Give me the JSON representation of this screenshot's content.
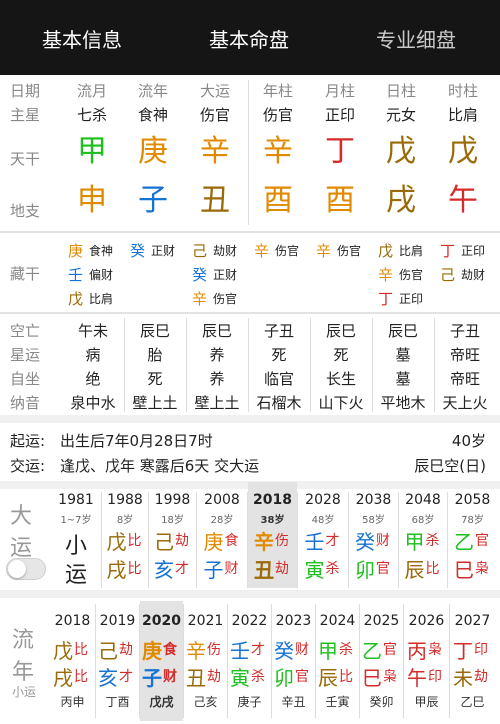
{
  "colors": {
    "wood": "#1fbf1f",
    "fire": "#d42b2b",
    "earth": "#9a6a06",
    "metal": "#e08a00",
    "water": "#1673d4",
    "gray": "#888888"
  },
  "tabs": [
    "基本信息",
    "基本命盘",
    "专业细盘"
  ],
  "grid": {
    "row_labels": [
      "日期",
      "主星",
      "天干",
      "地支"
    ],
    "dates": [
      "流月",
      "流年",
      "大运",
      "年柱",
      "月柱",
      "日柱",
      "时柱"
    ],
    "stars": [
      "七杀",
      "食神",
      "伤官",
      "伤官",
      "正印",
      "元女",
      "比肩"
    ],
    "stems": [
      {
        "t": "甲",
        "c": "wood"
      },
      {
        "t": "庚",
        "c": "metal"
      },
      {
        "t": "辛",
        "c": "metal"
      },
      {
        "t": "辛",
        "c": "metal"
      },
      {
        "t": "丁",
        "c": "fire"
      },
      {
        "t": "戊",
        "c": "earth"
      },
      {
        "t": "戊",
        "c": "earth"
      }
    ],
    "branches": [
      {
        "t": "申",
        "c": "metal"
      },
      {
        "t": "子",
        "c": "water"
      },
      {
        "t": "丑",
        "c": "earth"
      },
      {
        "t": "酉",
        "c": "metal"
      },
      {
        "t": "酉",
        "c": "metal"
      },
      {
        "t": "戌",
        "c": "earth"
      },
      {
        "t": "午",
        "c": "fire"
      }
    ]
  },
  "canggan": {
    "label": "藏干",
    "cols": [
      [
        {
          "s": "庚",
          "c": "metal",
          "n": "食神"
        },
        {
          "s": "壬",
          "c": "water",
          "n": "偏财"
        },
        {
          "s": "戊",
          "c": "earth",
          "n": "比肩"
        }
      ],
      [
        {
          "s": "癸",
          "c": "water",
          "n": "正财"
        }
      ],
      [
        {
          "s": "己",
          "c": "earth",
          "n": "劫财"
        },
        {
          "s": "癸",
          "c": "water",
          "n": "正财"
        },
        {
          "s": "辛",
          "c": "metal",
          "n": "伤官"
        }
      ],
      [
        {
          "s": "辛",
          "c": "metal",
          "n": "伤官"
        }
      ],
      [
        {
          "s": "辛",
          "c": "metal",
          "n": "伤官"
        }
      ],
      [
        {
          "s": "戊",
          "c": "earth",
          "n": "比肩"
        },
        {
          "s": "辛",
          "c": "metal",
          "n": "伤官"
        },
        {
          "s": "丁",
          "c": "fire",
          "n": "正印"
        }
      ],
      [
        {
          "s": "丁",
          "c": "fire",
          "n": "正印"
        },
        {
          "s": "己",
          "c": "earth",
          "n": "劫财"
        }
      ]
    ]
  },
  "extra": {
    "labels": [
      "空亡",
      "星运",
      "自坐",
      "纳音"
    ],
    "rows": [
      [
        "午未",
        "辰巳",
        "辰巳",
        "子丑",
        "辰巳",
        "辰巳",
        "子丑"
      ],
      [
        "病",
        "胎",
        "养",
        "死",
        "死",
        "墓",
        "帝旺"
      ],
      [
        "绝",
        "死",
        "养",
        "临官",
        "长生",
        "墓",
        "帝旺"
      ],
      [
        "泉中水",
        "壁上土",
        "壁上土",
        "石榴木",
        "山下火",
        "平地木",
        "天上火"
      ]
    ]
  },
  "qiyun": {
    "label1": "起运:",
    "text1": "出生后7年0月28日7时",
    "right1": "40岁",
    "label2": "交运:",
    "text2": "逢戊、戊年 寒露后6天 交大运",
    "right2": "辰巳空(日)"
  },
  "dayun": {
    "label": [
      "大",
      "运"
    ],
    "first": {
      "year": "1981",
      "age": "1~7岁",
      "t": [
        "小",
        "运"
      ]
    },
    "items": [
      {
        "year": "1988",
        "age": "8岁",
        "s": "戊",
        "sc": "earth",
        "sg": "比",
        "sgc": "fire",
        "b": "戌",
        "bc": "earth",
        "bg": "比",
        "bgc": "fire"
      },
      {
        "year": "1998",
        "age": "18岁",
        "s": "己",
        "sc": "earth",
        "sg": "劫",
        "sgc": "fire",
        "b": "亥",
        "bc": "water",
        "bg": "才",
        "bgc": "fire"
      },
      {
        "year": "2008",
        "age": "28岁",
        "s": "庚",
        "sc": "metal",
        "sg": "食",
        "sgc": "fire",
        "b": "子",
        "bc": "water",
        "bg": "财",
        "bgc": "fire"
      },
      {
        "year": "2018",
        "age": "38岁",
        "s": "辛",
        "sc": "metal",
        "sg": "伤",
        "sgc": "fire",
        "b": "丑",
        "bc": "earth",
        "bg": "劫",
        "bgc": "fire",
        "hl": true
      },
      {
        "year": "2028",
        "age": "48岁",
        "s": "壬",
        "sc": "water",
        "sg": "才",
        "sgc": "fire",
        "b": "寅",
        "bc": "wood",
        "bg": "杀",
        "bgc": "fire"
      },
      {
        "year": "2038",
        "age": "58岁",
        "s": "癸",
        "sc": "water",
        "sg": "财",
        "sgc": "fire",
        "b": "卯",
        "bc": "wood",
        "bg": "官",
        "bgc": "fire"
      },
      {
        "year": "2048",
        "age": "68岁",
        "s": "甲",
        "sc": "wood",
        "sg": "杀",
        "sgc": "fire",
        "b": "辰",
        "bc": "earth",
        "bg": "比",
        "bgc": "fire"
      },
      {
        "year": "2058",
        "age": "78岁",
        "s": "乙",
        "sc": "wood",
        "sg": "官",
        "sgc": "fire",
        "b": "巳",
        "bc": "fire",
        "bg": "枭",
        "bgc": "fire"
      }
    ]
  },
  "liunian": {
    "label": [
      "流",
      "年"
    ],
    "sub": "小运",
    "items": [
      {
        "year": "2018",
        "s": "戊",
        "sc": "earth",
        "sg": "比",
        "b": "戌",
        "bc": "earth",
        "bg": "比",
        "xy": "丙申"
      },
      {
        "year": "2019",
        "s": "己",
        "sc": "earth",
        "sg": "劫",
        "b": "亥",
        "bc": "water",
        "bg": "才",
        "xy": "丁酉"
      },
      {
        "year": "2020",
        "s": "庚",
        "sc": "metal",
        "sg": "食",
        "b": "子",
        "bc": "water",
        "bg": "财",
        "xy": "戊戌",
        "hl": true
      },
      {
        "year": "2021",
        "s": "辛",
        "sc": "metal",
        "sg": "伤",
        "b": "丑",
        "bc": "earth",
        "bg": "劫",
        "xy": "己亥"
      },
      {
        "year": "2022",
        "s": "壬",
        "sc": "water",
        "sg": "才",
        "b": "寅",
        "bc": "wood",
        "bg": "杀",
        "xy": "庚子"
      },
      {
        "year": "2023",
        "s": "癸",
        "sc": "water",
        "sg": "财",
        "b": "卯",
        "bc": "wood",
        "bg": "官",
        "xy": "辛丑"
      },
      {
        "year": "2024",
        "s": "甲",
        "sc": "wood",
        "sg": "杀",
        "b": "辰",
        "bc": "earth",
        "bg": "比",
        "xy": "壬寅"
      },
      {
        "year": "2025",
        "s": "乙",
        "sc": "wood",
        "sg": "官",
        "b": "巳",
        "bc": "fire",
        "bg": "枭",
        "xy": "癸卯"
      },
      {
        "year": "2026",
        "s": "丙",
        "sc": "fire",
        "sg": "枭",
        "b": "午",
        "bc": "fire",
        "bg": "印",
        "xy": "甲辰"
      },
      {
        "year": "2027",
        "s": "丁",
        "sc": "fire",
        "sg": "印",
        "b": "未",
        "bc": "earth",
        "bg": "劫",
        "xy": "乙巳"
      }
    ]
  }
}
